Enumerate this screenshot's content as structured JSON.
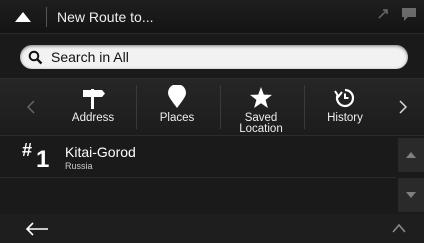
{
  "header": {
    "title": "New Route to..."
  },
  "search": {
    "placeholder": "Search in All"
  },
  "categories": [
    {
      "label": "Address",
      "icon": "signpost-icon"
    },
    {
      "label": "Places",
      "icon": "map-pin-icon"
    },
    {
      "label": "Saved\nLocation",
      "icon": "star-icon"
    },
    {
      "label": "History",
      "icon": "history-icon"
    }
  ],
  "results": [
    {
      "rank_symbol": "#",
      "rank": "1",
      "name": "Kitai-Gorod",
      "sub": "Russia"
    }
  ],
  "colors": {
    "background": "#1a1a1a",
    "search_bg": "#f2f2f2",
    "text": "#ffffff"
  }
}
